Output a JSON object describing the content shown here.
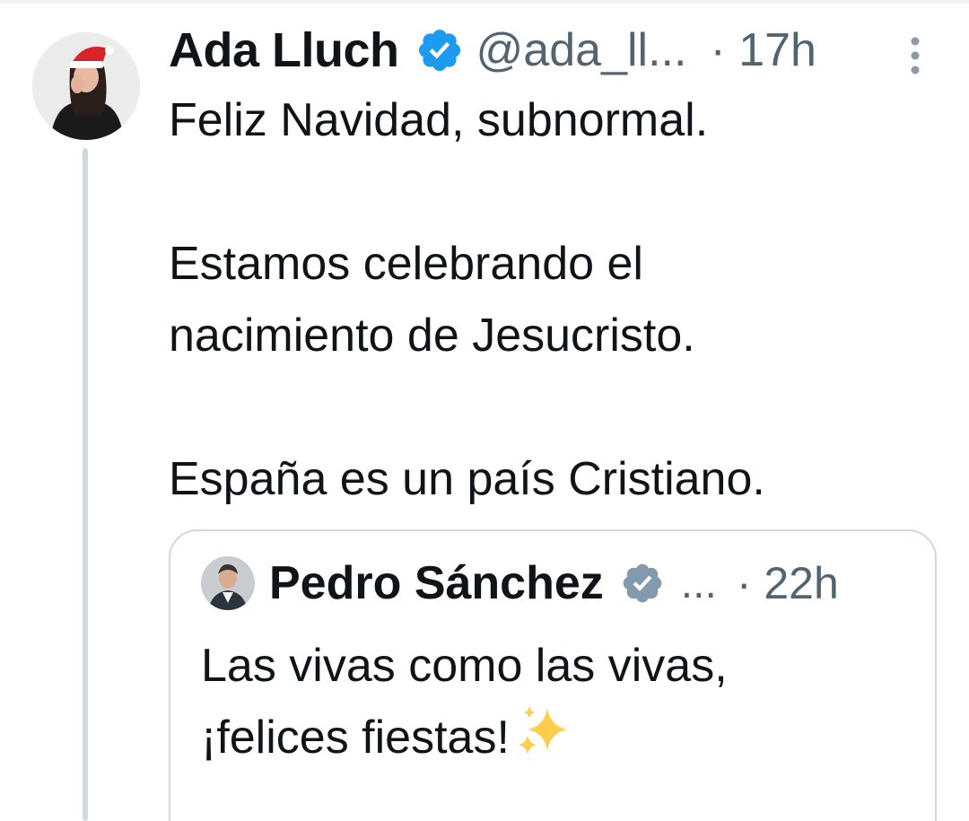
{
  "tweet": {
    "author": {
      "display_name": "Ada Lluch",
      "handle": "@ada_ll...",
      "verified_icon": "verified-badge-icon",
      "avatar_icon": "avatar-santa-hat"
    },
    "time": "· 17h",
    "more_icon": "more-vertical-icon",
    "text_lines": [
      "Feliz Navidad, subnormal.",
      "",
      "Estamos celebrando el",
      "nacimiento de Jesucristo.",
      "",
      "España es un país Cristiano."
    ]
  },
  "quoted_tweet": {
    "author": {
      "display_name": "Pedro Sánchez",
      "verified_icon": "verified-badge-grey-icon",
      "ellipsis": "..."
    },
    "time": "· 22h",
    "text_lines": [
      "Las vivas como las vivas,",
      "¡felices fiestas!"
    ],
    "emoji_icon": "sparkles-icon"
  },
  "colors": {
    "text_primary": "#0f1419",
    "text_secondary": "#536471",
    "verified_blue": "#1d9bf0",
    "verified_grey": "#829aab",
    "border": "#cfd9de"
  }
}
